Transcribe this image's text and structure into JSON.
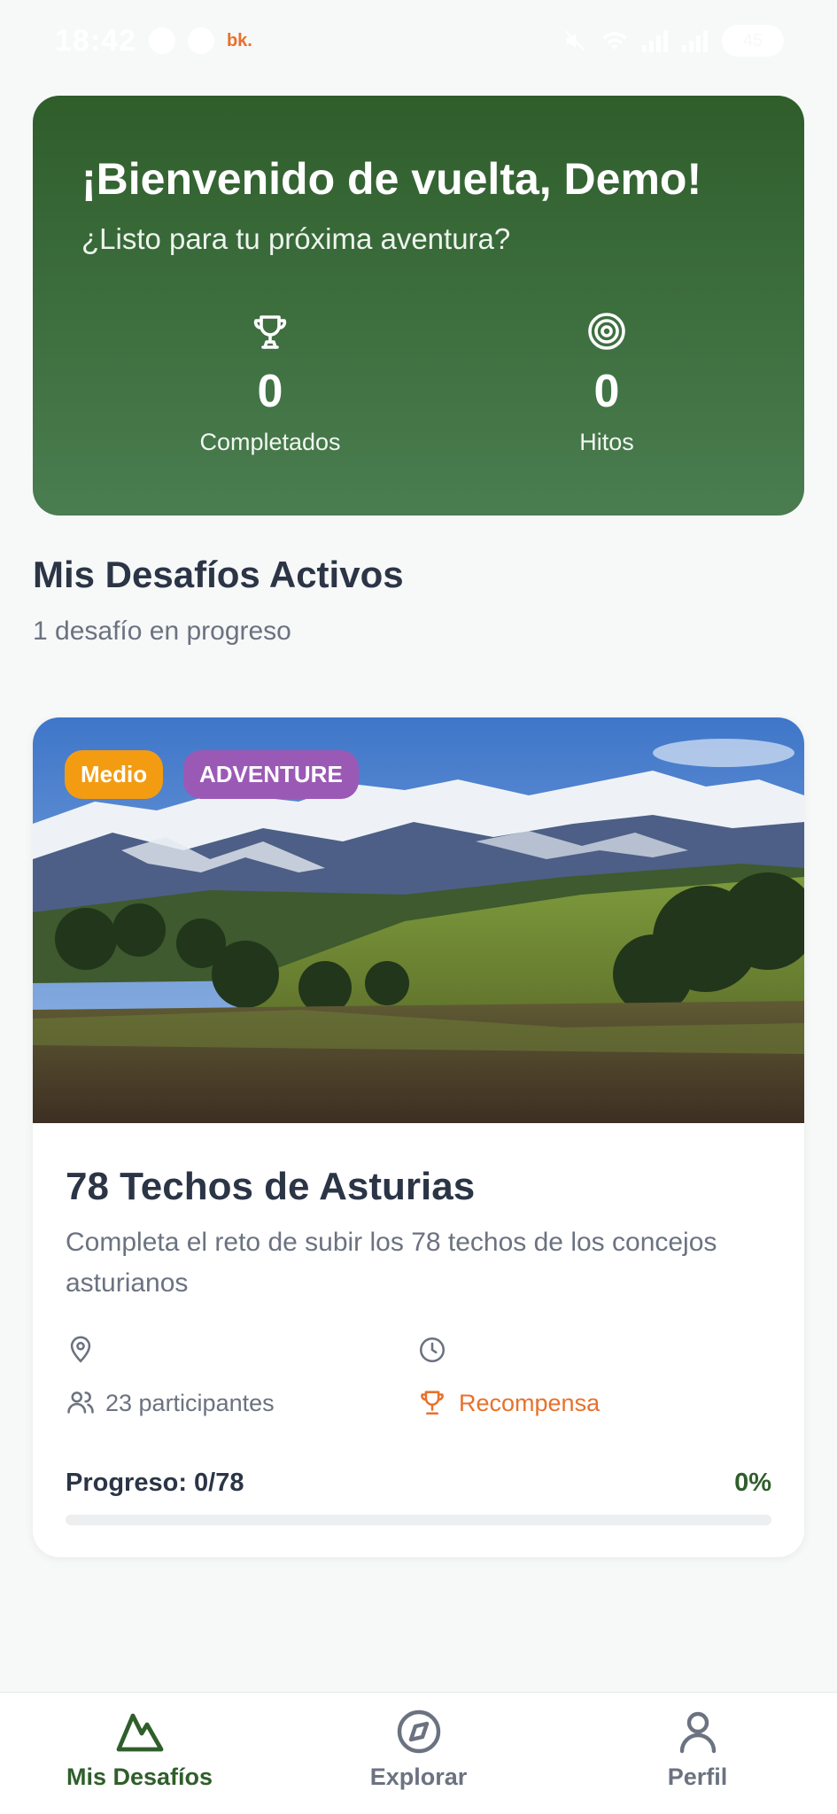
{
  "status_bar": {
    "time": "18:42",
    "brand": "bk.",
    "battery": "45"
  },
  "hero": {
    "title": "¡Bienvenido de vuelta, Demo!",
    "subtitle": "¿Listo para tu próxima aventura?",
    "stats": [
      {
        "icon": "trophy-icon",
        "value": "0",
        "label": "Completados"
      },
      {
        "icon": "target-icon",
        "value": "0",
        "label": "Hitos"
      }
    ]
  },
  "section": {
    "title": "Mis Desafíos Activos",
    "subtitle": "1 desafío en progreso"
  },
  "challenge": {
    "badges": {
      "level": "Medio",
      "category": "ADVENTURE"
    },
    "title": "78 Techos de Asturias",
    "description": "Completa el reto de subir los 78 techos de los concejos asturianos",
    "participants": "23 participantes",
    "reward": "Recompensa",
    "progress_label": "Progreso: 0/78",
    "progress_percent_text": "0%",
    "progress_fraction": 0
  },
  "nav": {
    "items": [
      {
        "label": "Mis Desafíos",
        "icon": "mountain-icon",
        "active": true
      },
      {
        "label": "Explorar",
        "icon": "compass-icon",
        "active": false
      },
      {
        "label": "Perfil",
        "icon": "user-icon",
        "active": false
      }
    ]
  },
  "colors": {
    "primary": "#2f5e2b",
    "accent_orange": "#e8712b",
    "badge_level": "#f39c12",
    "badge_category": "#9b59b6",
    "text_dark": "#2b3546",
    "text_muted": "#6b7280"
  }
}
